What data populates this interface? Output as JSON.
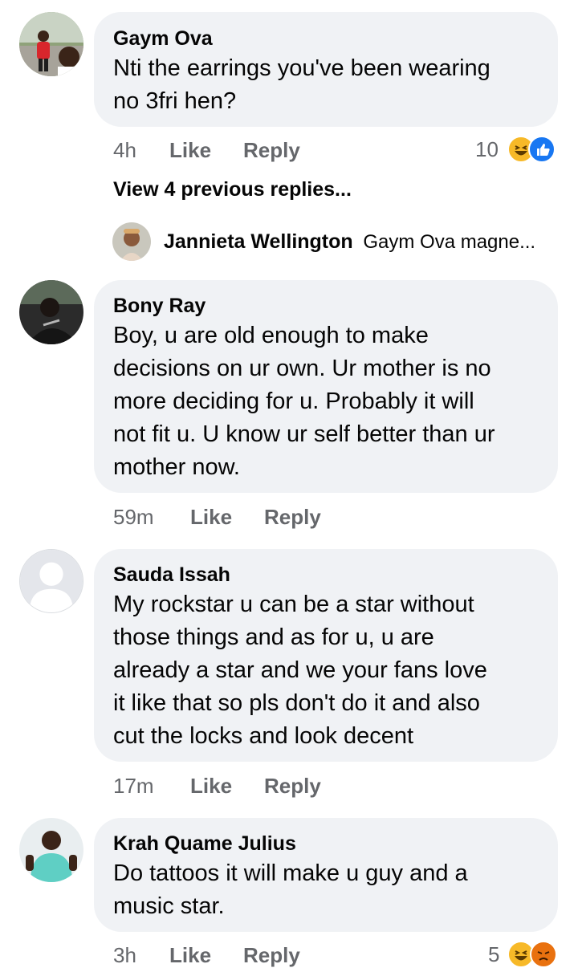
{
  "comments": [
    {
      "author": "Gaym Ova",
      "text": "Nti the earrings you've been wearing\nno 3fri hen?",
      "time": "4h",
      "like": "Like",
      "reply": "Reply",
      "reaction_count": "10",
      "reactions": [
        "haha",
        "like"
      ]
    },
    {
      "author": "Bony Ray",
      "text": "Boy, u are old enough to make\ndecisions on ur own. Ur mother is no\nmore  deciding for u. Probably it will\nnot fit u. U know ur self better than ur\nmother now.",
      "time": "59m",
      "like": "Like",
      "reply": "Reply"
    },
    {
      "author": "Sauda Issah",
      "text": "My rockstar u can be a star without\nthose things and as for u, u are\nalready a star and we your fans love\nit like that so pls don't do it and also\ncut the locks and look decent",
      "time": "17m",
      "like": "Like",
      "reply": "Reply"
    },
    {
      "author": "Krah Quame Julius",
      "text": "Do tattoos it will make u guy and a\nmusic star.",
      "time": "3h",
      "like": "Like",
      "reply": "Reply",
      "reaction_count": "5",
      "reactions": [
        "haha",
        "angry"
      ]
    }
  ],
  "view_replies": "View 4 previous replies...",
  "reply_preview": {
    "author": "Jannieta Wellington",
    "snippet": "Gaym Ova magne..."
  },
  "colors": {
    "bubble": "#f0f2f5",
    "secondary_text": "#65676b",
    "like_blue": "#1877f2",
    "haha_yellow": "#f7b928",
    "angry_orange": "#e9710f"
  }
}
